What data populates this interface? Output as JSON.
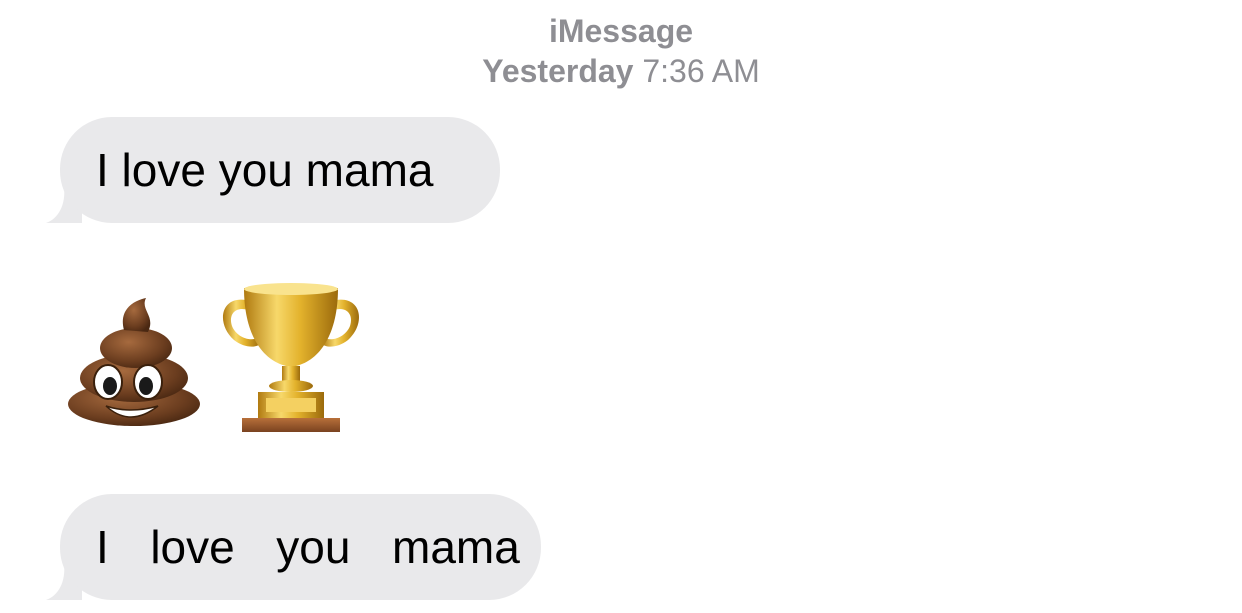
{
  "header": {
    "service": "iMessage",
    "day": "Yesterday",
    "time": "7:36 AM"
  },
  "messages": [
    {
      "text": "I love you mama"
    },
    {
      "emojis": [
        "pile-of-poo-icon",
        "trophy-icon"
      ]
    },
    {
      "text": "I  love  you  mama"
    }
  ],
  "colors": {
    "bubble_received": "#e9e9eb",
    "header_text": "#8e8e93",
    "background": "#ffffff"
  }
}
